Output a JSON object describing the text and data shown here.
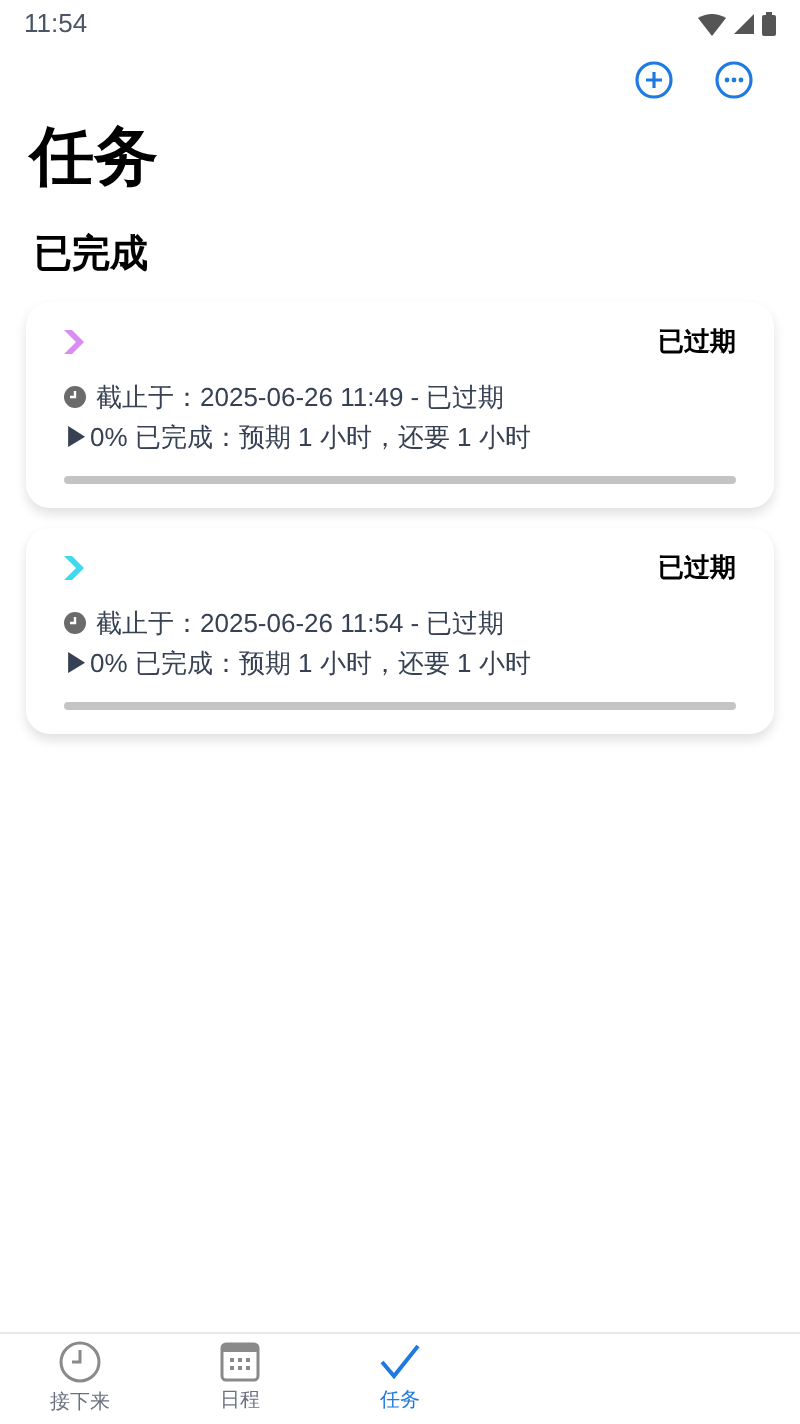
{
  "status_bar": {
    "time": "11:54"
  },
  "title": "任务",
  "section": "已完成",
  "tasks": [
    {
      "color": "#d98cf2",
      "status": "已过期",
      "due": "截止于：2025-06-26 11:49 - 已过期",
      "progress": "▶0% 已完成：预期 1 小时，还要 1 小时",
      "level": 0
    },
    {
      "color": "#3fd8ec",
      "status": "已过期",
      "due": "截止于：2025-06-26 11:54 - 已过期",
      "progress": "▶0% 已完成：预期 1 小时，还要 1 小时",
      "level": 0
    }
  ],
  "tabs": [
    {
      "kind": "clock",
      "label": "接下来",
      "selected": false
    },
    {
      "kind": "calendar",
      "label": "日程",
      "selected": false
    },
    {
      "kind": "check",
      "label": "任务",
      "selected": true
    }
  ]
}
